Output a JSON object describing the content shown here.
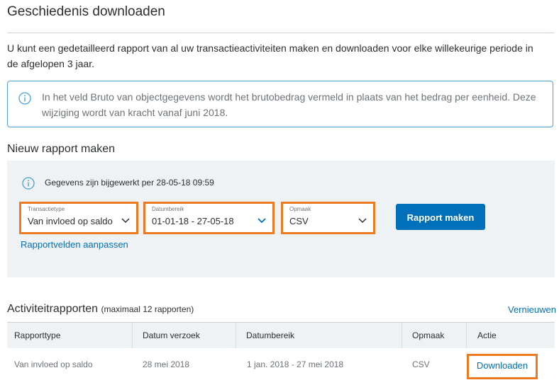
{
  "page": {
    "title": "Geschiedenis downloaden",
    "intro": "U kunt een gedetailleerd rapport van al uw transactieactiviteiten maken en downloaden voor elke willekeurige periode in de afgelopen 3 jaar.",
    "notice": "In het veld Bruto van objectgegevens wordt het brutobedrag vermeld in plaats van het bedrag per eenheid. Deze wijziging wordt van kracht vanaf juni 2018."
  },
  "new_report": {
    "heading": "Nieuw rapport maken",
    "updated_text": "Gegevens zijn bijgewerkt per 28-05-18 09:59",
    "transaction_type": {
      "label": "Transactietype",
      "value": "Van invloed op saldo"
    },
    "date_range": {
      "label": "Datumbereik",
      "value": "01-01-18 - 27-05-18"
    },
    "format": {
      "label": "Opmaak",
      "value": "CSV"
    },
    "create_button": "Rapport maken",
    "customize_link": "Rapportvelden aanpassen"
  },
  "activity": {
    "heading": "Activiteitrapporten",
    "subheading": "(maximaal 12 rapporten)",
    "refresh_link": "Vernieuwen",
    "columns": [
      "Rapporttype",
      "Datum verzoek",
      "Datumbereik",
      "Opmaak",
      "Actie"
    ],
    "rows": [
      {
        "type": "Van invloed op saldo",
        "requested": "28 mei 2018",
        "range": "1 jan. 2018 - 27 mei 2018",
        "format": "CSV",
        "action": "Downloaden"
      }
    ]
  },
  "colors": {
    "accent": "#0070ba",
    "highlight": "#ec7a21",
    "panel": "#eff2f5"
  }
}
